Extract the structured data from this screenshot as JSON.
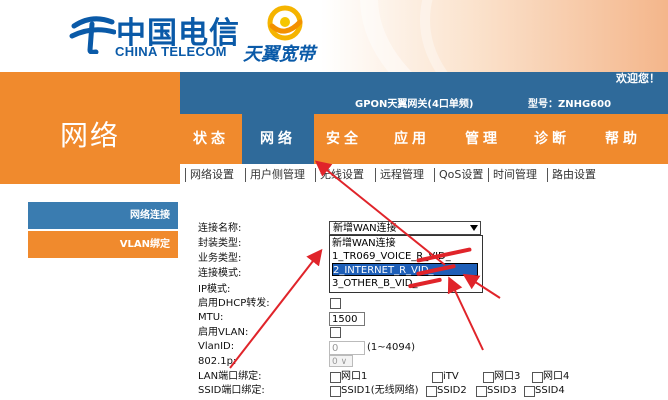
{
  "header": {
    "logo_cn": "中国电信",
    "logo_en": "CHINA TELECOM",
    "tianyi": "天翼宽带",
    "welcome": "欢迎您！"
  },
  "device": {
    "name": "GPON天翼网关(4口单频)",
    "model": "型号：ZNHG600"
  },
  "section_title": "网络",
  "nav": [
    "状态",
    "网络",
    "安全",
    "应用",
    "管理",
    "诊断",
    "帮助"
  ],
  "subnav": [
    "网络设置",
    "用户侧管理",
    "无线设置",
    "远程管理",
    "QoS设置",
    "时间管理",
    "路由设置"
  ],
  "sidebar": [
    "网络连接",
    "VLAN绑定"
  ],
  "form": {
    "labels": [
      "连接名称:",
      "封装类型:",
      "业务类型:",
      "连接模式:",
      "IP模式:",
      "启用DHCP转发:",
      "MTU:",
      "启用VLAN:",
      "VlanID:",
      "802.1p:",
      "LAN端口绑定:",
      "SSID端口绑定:"
    ],
    "connection_name": "新增WAN连接",
    "dropdown_options": [
      "新增WAN连接",
      "1_TR069_VOICE_R_VID_",
      "2_INTERNET_R_VID_",
      "3_OTHER_B_VID_"
    ],
    "selected_option_index": 2,
    "mtu": "1500",
    "vlan_id": "0",
    "vlan_range": "(1~4094)",
    "p8021": "0",
    "lan_ports": [
      "网口1",
      "iTV",
      "网口3",
      "网口4"
    ],
    "ssids": [
      "SSID1(无线网络)",
      "SSID2",
      "SSID3",
      "SSID4"
    ]
  },
  "colors": {
    "orange": "#f08a2d",
    "blue": "#2f6a9a",
    "annotation_red": "#e0242a"
  }
}
